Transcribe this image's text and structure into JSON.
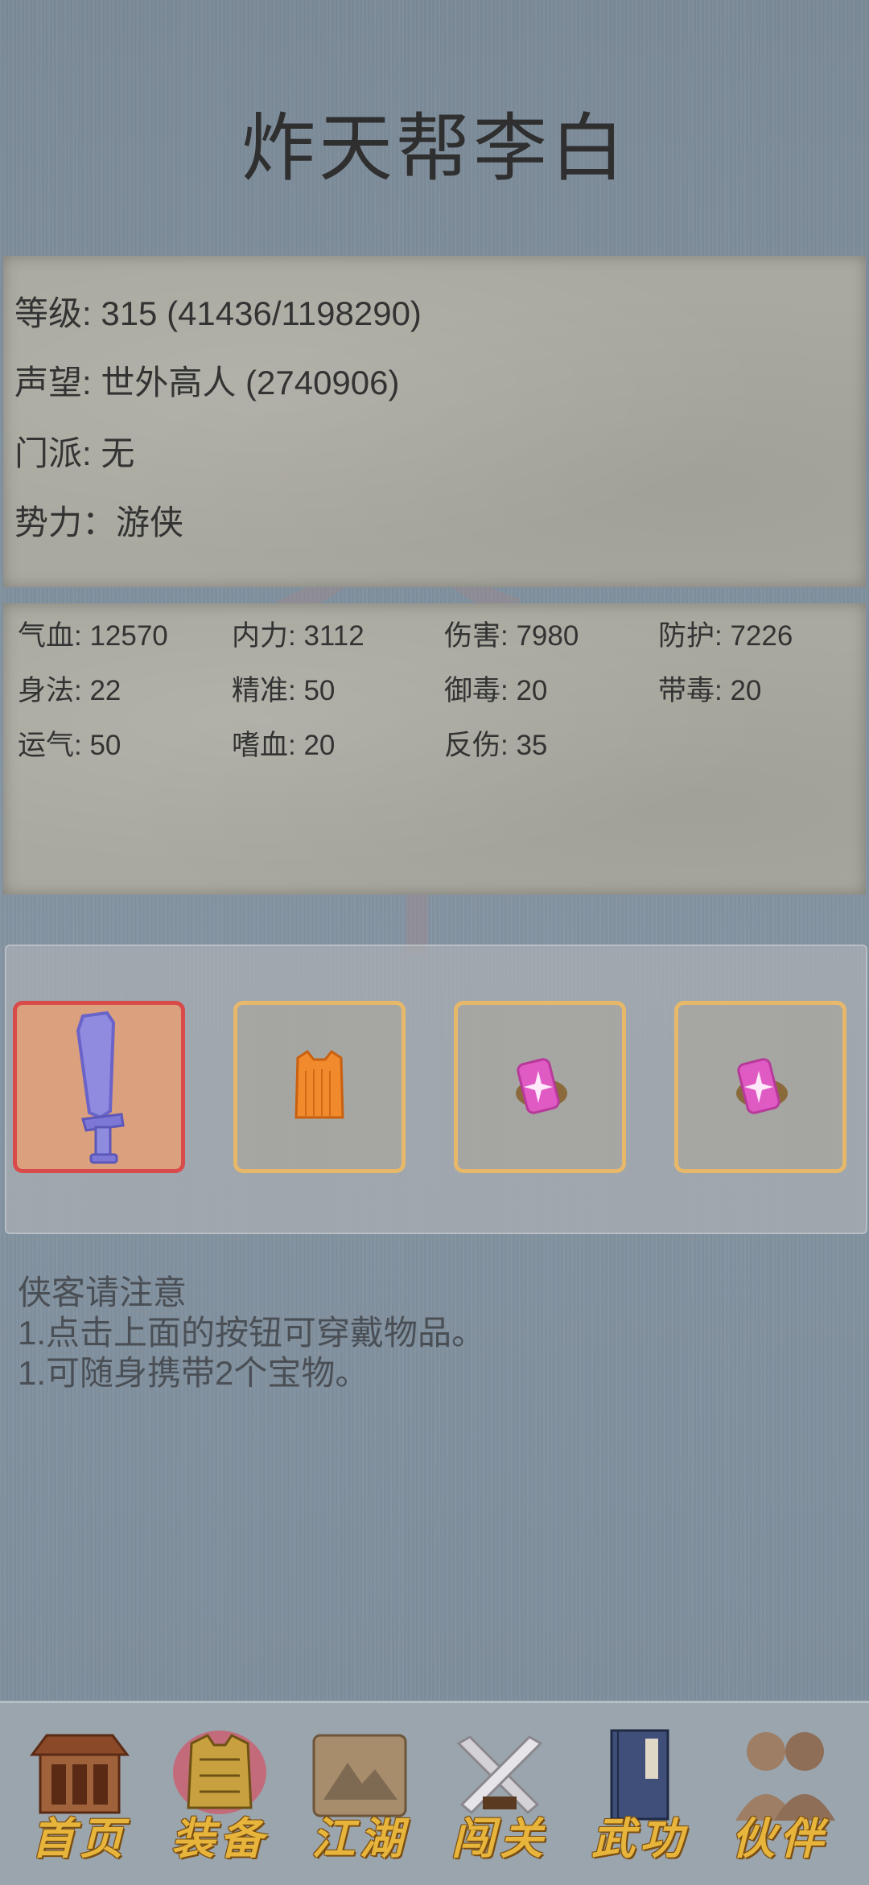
{
  "header": {
    "title": "炸天帮李白"
  },
  "profile": {
    "level": "等级: 315 (41436/1198290)",
    "prestige": "声望: 世外高人 (2740906)",
    "sect": "门派: 无",
    "faction": "势力：游侠"
  },
  "stats": [
    "气血: 12570",
    "内力: 3112",
    "伤害: 7980",
    "防护: 7226",
    "身法: 22",
    "精准: 50",
    "御毒: 20",
    "带毒: 20",
    "运气: 50",
    "嗜血: 20",
    "反伤: 35"
  ],
  "equipment": {
    "slots": [
      {
        "item": "broadsword-icon",
        "selected": true
      },
      {
        "item": "armor-icon",
        "selected": false
      },
      {
        "item": "treasure-icon",
        "selected": false
      },
      {
        "item": "treasure-icon",
        "selected": false
      }
    ]
  },
  "notice": {
    "heading": "侠客请注意",
    "line1": "1.点击上面的按钮可穿戴物品。",
    "line2": "1.可随身携带2个宝物。"
  },
  "nav": [
    {
      "label": "首页",
      "icon": "house-icon"
    },
    {
      "label": "装备",
      "icon": "armor-icon",
      "active": true
    },
    {
      "label": "江湖",
      "icon": "scroll-icon"
    },
    {
      "label": "闯关",
      "icon": "swords-icon"
    },
    {
      "label": "武功",
      "icon": "book-icon"
    },
    {
      "label": "伙伴",
      "icon": "partners-icon"
    }
  ],
  "colors": {
    "background": "#7e8d9b",
    "slot_border": "#e8b86a",
    "slot_selected_border": "#d94a4a",
    "nav_label": "#e7b53c"
  }
}
